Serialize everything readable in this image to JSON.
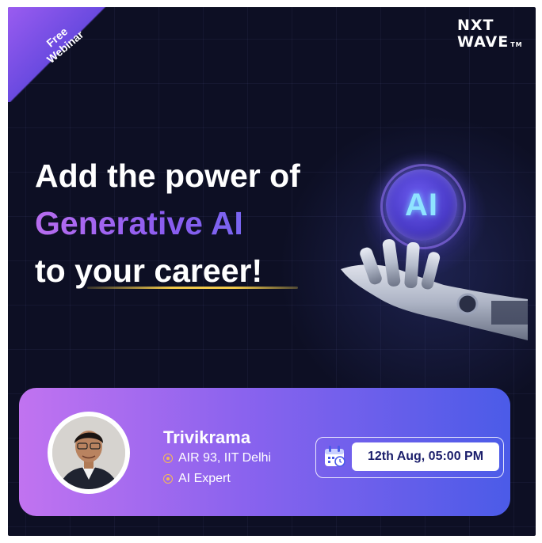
{
  "ribbon": {
    "line1": "Free",
    "line2": "Webinar"
  },
  "logo": {
    "line1": "NXT",
    "line2": "WAVE",
    "tm": "TM"
  },
  "headline": {
    "line1": "Add the power of",
    "line2": "Generative AI",
    "line3_a": "to ",
    "line3_b": "your career!"
  },
  "orb": {
    "label": "AI"
  },
  "speaker": {
    "name": "Trivikrama",
    "credential1": "AIR 93, IIT Delhi",
    "credential2": "AI Expert"
  },
  "event": {
    "date_time": "12th Aug, 05:00 PM"
  },
  "colors": {
    "background": "#0d0f24",
    "accent_purple": "#9a5cf0",
    "accent_blue": "#4b5be8",
    "underline_gold": "#f0c84a"
  }
}
